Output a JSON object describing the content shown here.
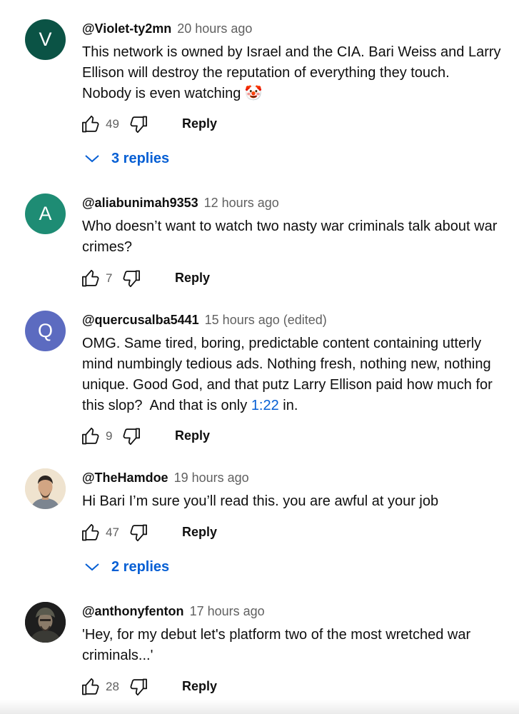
{
  "comments": [
    {
      "handle": "@Violet-ty2mn",
      "time": "20 hours ago",
      "avatar_letter": "V",
      "avatar_color": "#0b5345",
      "lines": [
        "This network is owned by Israel and the CIA. Bari Weiss and Larry",
        "Ellison will destroy the reputation of everything they touch.",
        "Nobody is even watching 🤡"
      ],
      "likes": "49",
      "reply_label": "Reply",
      "replies_label": "3 replies"
    },
    {
      "handle": "@aliabunimah9353",
      "time": "12 hours ago",
      "avatar_letter": "A",
      "avatar_color": "#1e8c74",
      "lines": [
        "Who doesn’t want to watch two nasty war criminals talk about war",
        "crimes?"
      ],
      "likes": "7",
      "reply_label": "Reply"
    },
    {
      "handle": "@quercusalba5441",
      "time": "15 hours ago (edited)",
      "avatar_letter": "Q",
      "avatar_color": "#5c6bc0",
      "lines": [
        "OMG.  Same tired, boring, predictable content containing utterly",
        "mind numbingly tedious ads.  Nothing fresh, nothing new, nothing",
        "unique.  Good God, and that putz Larry Ellison paid how much for",
        "this slop?  And that is only "
      ],
      "timestamp_link": "1:22",
      "after_link": " in.",
      "likes": "9",
      "reply_label": "Reply"
    },
    {
      "handle": "@TheHamdoe",
      "time": "19 hours ago",
      "lines": [
        "Hi Bari I’m sure you’ll read this. you are awful at your job"
      ],
      "likes": "47",
      "reply_label": "Reply",
      "replies_label": "2 replies"
    },
    {
      "handle": "@anthonyfenton",
      "time": "17 hours ago",
      "lines": [
        "'Hey, for my debut let's platform two of the most wretched war",
        "criminals...'"
      ],
      "likes": "28",
      "reply_label": "Reply"
    }
  ],
  "icons": {
    "like": "thumb-up-outline",
    "dislike": "thumb-down-outline",
    "expand": "chevron-down"
  },
  "colors": {
    "link_blue": "#065fd4",
    "meta_gray": "#606060",
    "text": "#0f0f0f"
  }
}
